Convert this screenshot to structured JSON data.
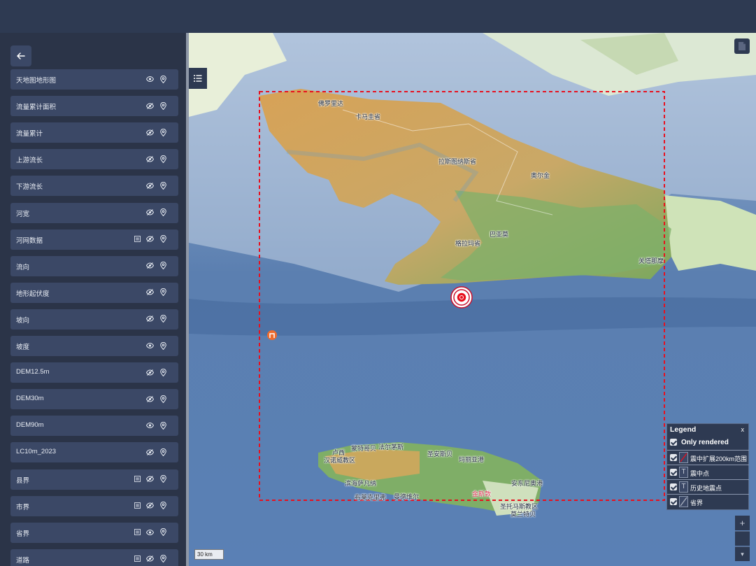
{
  "sidebar": {
    "back_icon": "arrow-left-icon",
    "layers": [
      {
        "label": "天地图地形图",
        "extra": false,
        "eye": "eye-icon"
      },
      {
        "label": "流量累计面积",
        "extra": false,
        "eye": "eye-off-icon"
      },
      {
        "label": "流量累计",
        "extra": false,
        "eye": "eye-off-icon"
      },
      {
        "label": "上游流长",
        "extra": false,
        "eye": "eye-off-icon"
      },
      {
        "label": "下游流长",
        "extra": false,
        "eye": "eye-off-icon"
      },
      {
        "label": "河宽",
        "extra": false,
        "eye": "eye-off-icon"
      },
      {
        "label": "河网数据",
        "extra": true,
        "eye": "eye-off-icon"
      },
      {
        "label": "流向",
        "extra": false,
        "eye": "eye-off-icon"
      },
      {
        "label": "地形起伏度",
        "extra": false,
        "eye": "eye-off-icon"
      },
      {
        "label": "坡向",
        "extra": false,
        "eye": "eye-off-icon"
      },
      {
        "label": "坡度",
        "extra": false,
        "eye": "eye-icon"
      },
      {
        "label": "DEM12.5m",
        "extra": false,
        "eye": "eye-off-icon"
      },
      {
        "label": "DEM30m",
        "extra": false,
        "eye": "eye-off-icon"
      },
      {
        "label": "DEM90m",
        "extra": false,
        "eye": "eye-icon"
      },
      {
        "label": "LC10m_2023",
        "extra": false,
        "eye": "eye-off-icon"
      },
      {
        "label": "县界",
        "extra": true,
        "eye": "eye-off-icon"
      },
      {
        "label": "市界",
        "extra": true,
        "eye": "eye-off-icon"
      },
      {
        "label": "省界",
        "extra": true,
        "eye": "eye-icon"
      },
      {
        "label": "道路",
        "extra": true,
        "eye": "eye-off-icon"
      }
    ]
  },
  "map": {
    "place_labels": [
      {
        "text": "佛罗里达"
      },
      {
        "text": "卡马圭省"
      },
      {
        "text": "拉斯图纳斯省"
      },
      {
        "text": "奥尔金"
      },
      {
        "text": "巴亚莫"
      },
      {
        "text": "格拉玛省"
      },
      {
        "text": "关塔那摩"
      },
      {
        "text": "卢西"
      },
      {
        "text": "蒙特哥贝"
      },
      {
        "text": "法尔茅斯"
      },
      {
        "text": "汉诺威教区"
      },
      {
        "text": "圣安斯贝"
      },
      {
        "text": "玛丽亚港"
      },
      {
        "text": "滨海萨凡纳"
      },
      {
        "text": "安东尼奥港"
      },
      {
        "text": "布莱克里弗"
      },
      {
        "text": "曼德维尔"
      },
      {
        "text": "金斯敦",
        "red": true
      },
      {
        "text": "圣托马斯教区"
      },
      {
        "text": "莫兰特贝"
      }
    ],
    "epicenter_icon": "epicenter-target-icon",
    "station_icon": "station-marker-icon",
    "scale": "30 km",
    "layer_toggle_icon": "list-icon",
    "print_icon": "document-icon",
    "zoom_in": "+",
    "zoom_out": "▾",
    "colors": {
      "extent_line": "#e8101e",
      "land": "#d9a65a",
      "sea": "#4f6f9c"
    }
  },
  "legend": {
    "title": "Legend",
    "close": "x",
    "only_rendered": "Only rendered",
    "entries": [
      {
        "label": "震中扩展200km范围",
        "symbol": "red-line-icon"
      },
      {
        "label": "震中点",
        "symbol": "text-symbol-icon"
      },
      {
        "label": "历史地震点",
        "symbol": "text-symbol-icon"
      },
      {
        "label": "省界",
        "symbol": "gray-line-icon"
      }
    ],
    "text_symbol": "T"
  }
}
